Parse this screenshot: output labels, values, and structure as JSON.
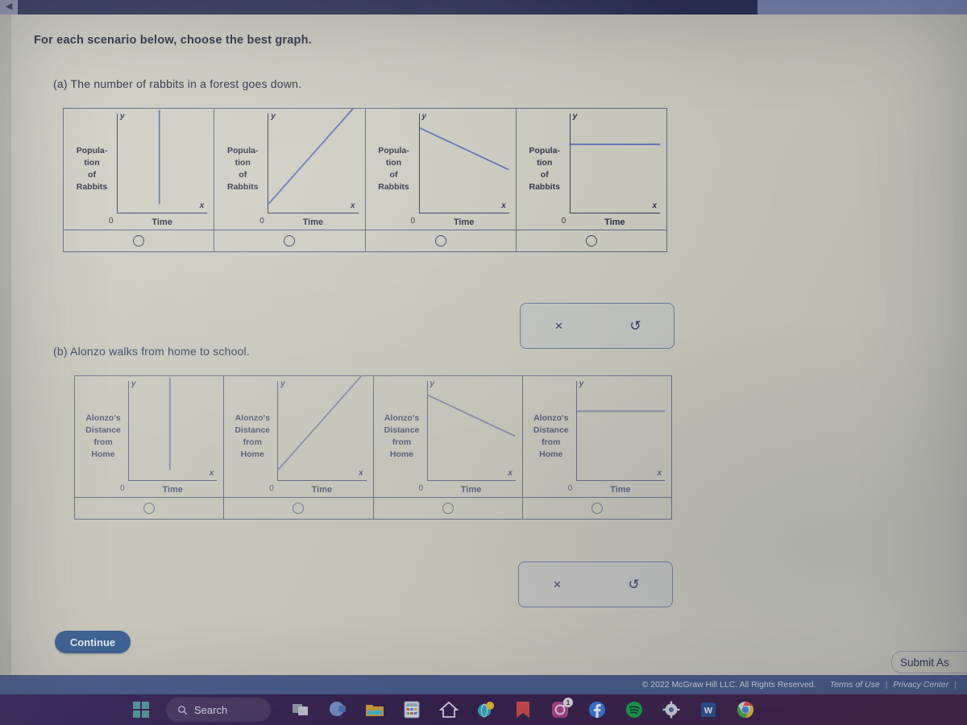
{
  "browser": {
    "back_icon": "back-arrow-icon"
  },
  "question": {
    "prompt": "For each scenario below, choose the best graph.",
    "parts": [
      {
        "id": "a",
        "label": "(a) The number of rabbits in a forest goes down.",
        "y_axis_label_lines": [
          "Popula-",
          "tion",
          "of",
          "Rabbits"
        ],
        "x_axis_label": "Time",
        "origin_label": "0",
        "y_tick": "y",
        "x_tick": "x",
        "options": [
          {
            "shape": "vertical-line"
          },
          {
            "shape": "increasing-line"
          },
          {
            "shape": "decreasing-line"
          },
          {
            "shape": "horizontal-line"
          }
        ]
      },
      {
        "id": "b",
        "label": "(b) Alonzo walks from home to school.",
        "y_axis_label_lines": [
          "Alonzo's",
          "Distance",
          "from",
          "Home"
        ],
        "x_axis_label": "Time",
        "origin_label": "0",
        "y_tick": "y",
        "x_tick": "x",
        "options": [
          {
            "shape": "vertical-line"
          },
          {
            "shape": "increasing-line"
          },
          {
            "shape": "decreasing-line"
          },
          {
            "shape": "horizontal-line"
          }
        ]
      }
    ]
  },
  "tools": {
    "clear_label": "×",
    "undo_label": "↺"
  },
  "footer": {
    "continue_label": "Continue",
    "submit_label": "Submit As",
    "copyright": "© 2022 McGraw Hill LLC. All Rights Reserved.",
    "terms_label": "Terms of Use",
    "privacy_label": "Privacy Center",
    "separator": "|"
  },
  "taskbar": {
    "search_placeholder": "Search",
    "items": [
      {
        "name": "start-button",
        "icon": "windows-logo-icon"
      },
      {
        "name": "search-box",
        "icon": "search-icon"
      },
      {
        "name": "task-view-button",
        "icon": "task-view-icon"
      },
      {
        "name": "teams-button",
        "icon": "teams-icon"
      },
      {
        "name": "file-explorer-button",
        "icon": "folder-icon"
      },
      {
        "name": "calculator-button",
        "icon": "calculator-icon"
      },
      {
        "name": "home-app-button",
        "icon": "house-icon"
      },
      {
        "name": "browser-button",
        "icon": "globe-icon"
      },
      {
        "name": "mail-button",
        "icon": "mail-icon"
      },
      {
        "name": "instagram-button",
        "icon": "instagram-icon",
        "badge": "1"
      },
      {
        "name": "facebook-button",
        "icon": "facebook-icon"
      },
      {
        "name": "spotify-button",
        "icon": "spotify-icon"
      },
      {
        "name": "settings-button",
        "icon": "gear-icon"
      },
      {
        "name": "word-button",
        "icon": "word-icon"
      },
      {
        "name": "chrome-button",
        "icon": "chrome-icon"
      }
    ]
  },
  "colors": {
    "page_background": "#cbcbbf",
    "curve": "#5a6ab5",
    "axis": "#2f3355",
    "continue_button": "#3c6396",
    "legal_bar": "#4a5e8c",
    "taskbar": "#35235a"
  }
}
